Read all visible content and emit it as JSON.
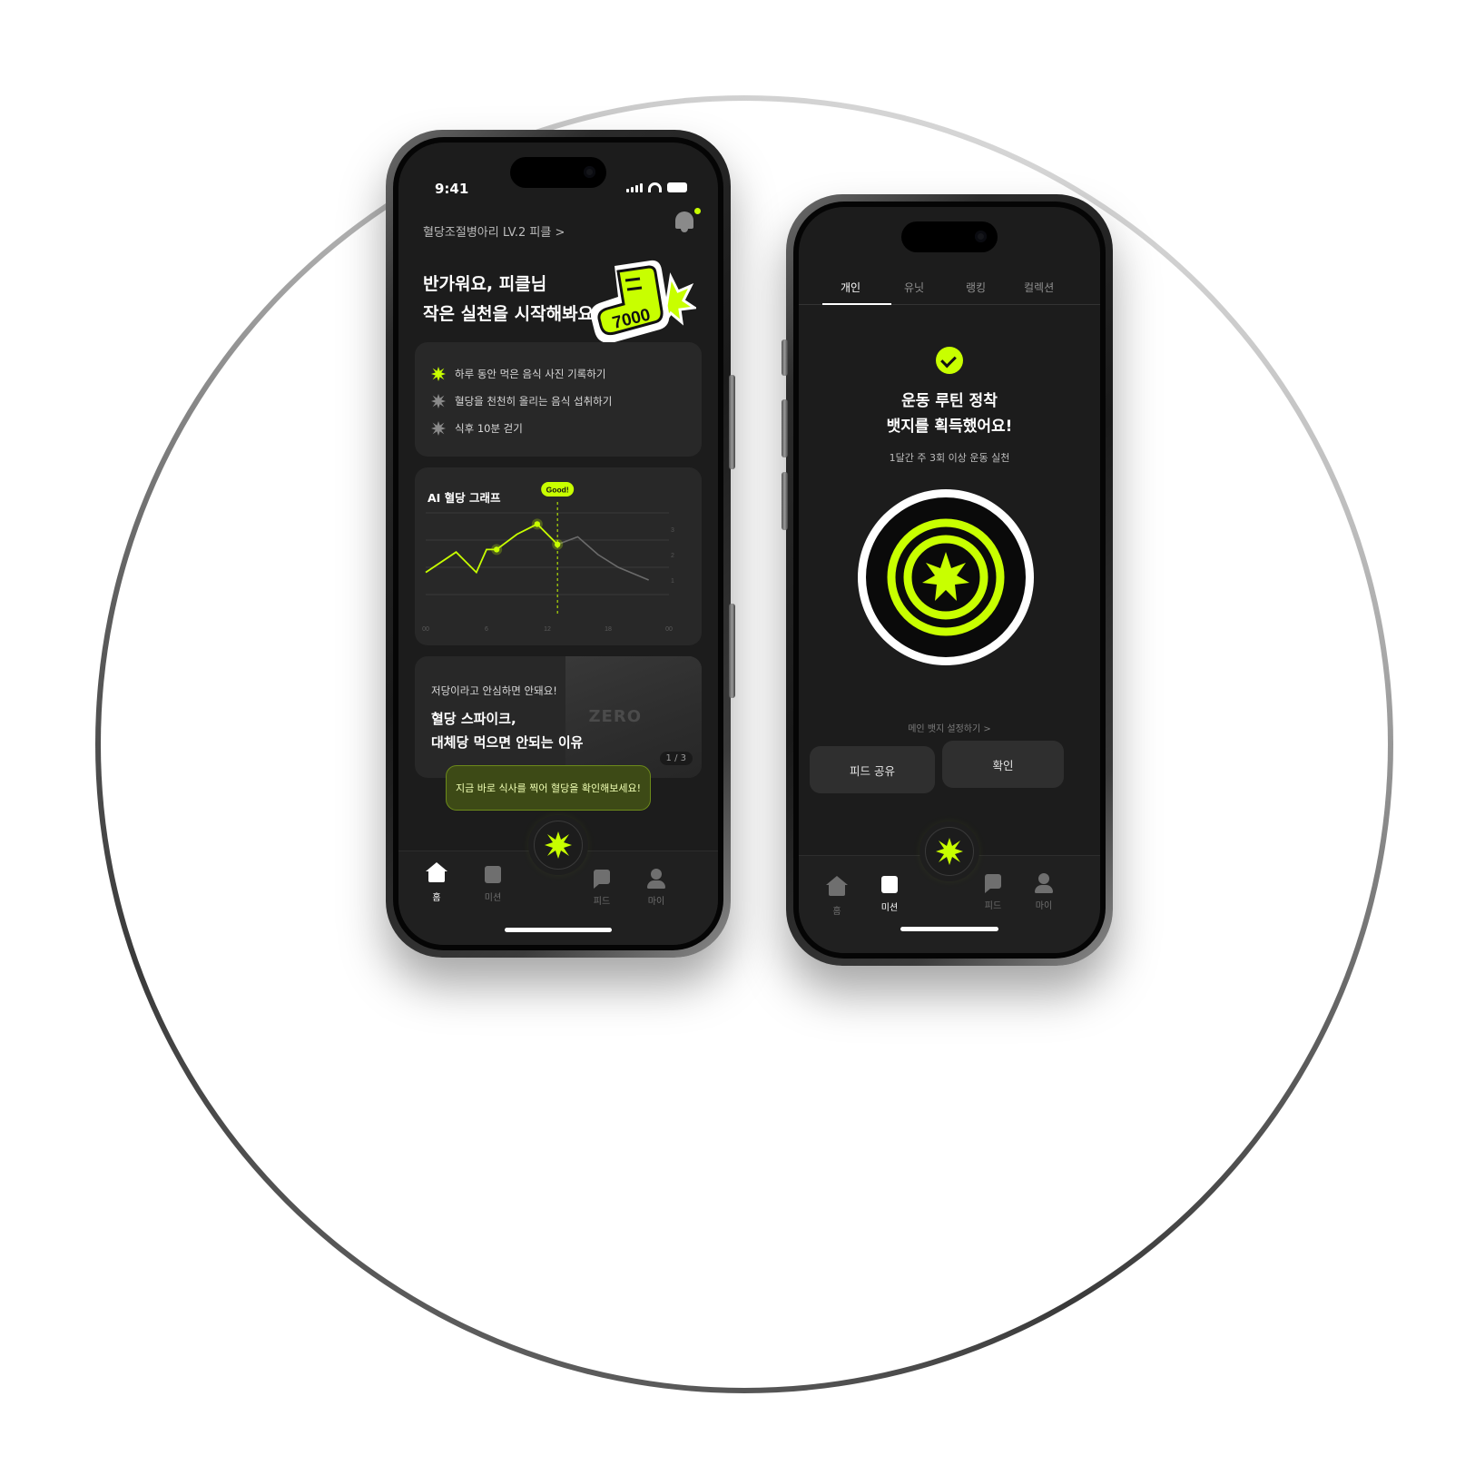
{
  "colors": {
    "accent": "#c8ff00",
    "screen_bg": "#1c1c1c",
    "card_bg": "#282828"
  },
  "home_screen": {
    "status_time": "9:41",
    "breadcrumb": "혈당조절병아리 LV.2 피클 >",
    "greeting_line1": "반가워요, 피클님",
    "greeting_line2": "작은 실천을 시작해봐요!",
    "sticker_number": "7000",
    "missions": [
      {
        "label": "하루 동안 먹은 음식 사진 기록하기",
        "active": true
      },
      {
        "label": "혈당을 천천히 올리는 음식 섭취하기",
        "active": false
      },
      {
        "label": "식후 10분 걷기",
        "active": false
      }
    ],
    "graph_title": "AI 혈당 그래프",
    "graph_tooltip": "Good!",
    "article_subtitle": "저당이라고 안심하면 안돼요!",
    "article_title_line1": "혈당 스파이크,",
    "article_title_line2": "대체당 먹으면 안되는 이유",
    "article_image_text": "ZERO",
    "article_pager": "1 / 3",
    "toast": "지금 바로 식사를 찍어 혈당을 확인해보세요!",
    "tabs": [
      {
        "label": "홈",
        "icon": "home-icon",
        "active": true
      },
      {
        "label": "미션",
        "icon": "mission-icon",
        "active": false
      },
      {
        "label": "피드",
        "icon": "feed-icon",
        "active": false
      },
      {
        "label": "마이",
        "icon": "my-icon",
        "active": false
      }
    ]
  },
  "chart_data": {
    "type": "line",
    "x_tick_labels": [
      "00",
      "6",
      "12",
      "18",
      "00"
    ],
    "y_tick_labels": [
      "3",
      "2",
      "1"
    ],
    "series": [
      {
        "x": [
          0,
          3,
          5,
          6,
          7,
          9,
          11,
          13,
          15,
          17,
          19,
          22
        ],
        "y": [
          1.3,
          2.1,
          1.3,
          2.2,
          2.2,
          2.8,
          3.2,
          2.4,
          2.7,
          2.0,
          1.5,
          1.0
        ]
      }
    ],
    "highlight_index": 7
  },
  "badge_screen": {
    "tabs": [
      "개인",
      "유닛",
      "랭킹",
      "컬렉션"
    ],
    "title_line1": "운동 루틴 정착",
    "title_line2": "뱃지를 획득했어요!",
    "subtitle": "1달간 주 3회 이상 운동 실천",
    "main_badge_link": "메인 뱃지 설정하기  >",
    "share_button": "피드 공유",
    "confirm_button": "확인",
    "tabbar": [
      {
        "label": "홈",
        "active": false
      },
      {
        "label": "미션",
        "active": true
      },
      {
        "label": "피드",
        "active": false
      },
      {
        "label": "마이",
        "active": false
      }
    ]
  }
}
